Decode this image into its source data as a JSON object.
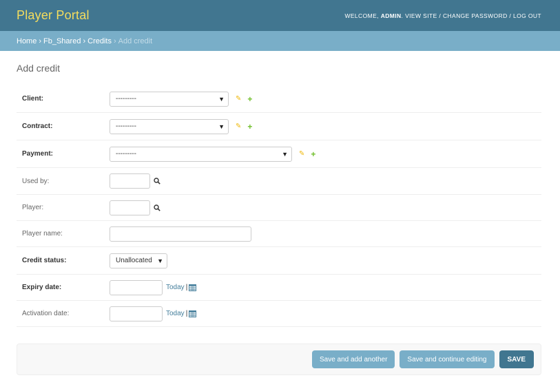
{
  "header": {
    "branding": "Player Portal",
    "welcome": "WELCOME,",
    "username": "ADMIN",
    "view_site": "VIEW SITE",
    "change_password": "CHANGE PASSWORD",
    "log_out": "LOG OUT",
    "separator": "/"
  },
  "breadcrumbs": {
    "home": "Home",
    "app": "Fb_Shared",
    "model": "Credits",
    "current": "Add credit",
    "separator": "›"
  },
  "page": {
    "title": "Add credit"
  },
  "form": {
    "client": {
      "label": "Client:",
      "value": "---------"
    },
    "contract": {
      "label": "Contract:",
      "value": "---------"
    },
    "payment": {
      "label": "Payment:",
      "value": "---------"
    },
    "used_by": {
      "label": "Used by:",
      "value": ""
    },
    "player": {
      "label": "Player:",
      "value": ""
    },
    "player_name": {
      "label": "Player name:",
      "value": ""
    },
    "credit_status": {
      "label": "Credit status:",
      "value": "Unallocated"
    },
    "expiry_date": {
      "label": "Expiry date:",
      "value": "",
      "today": "Today",
      "pipe": "|"
    },
    "activation_date": {
      "label": "Activation date:",
      "value": "",
      "today": "Today",
      "pipe": "|"
    }
  },
  "icons": {
    "dropdown_arrow": "▼",
    "edit": "✎",
    "add": "+"
  },
  "submit": {
    "save_add_another": "Save and add another",
    "save_continue": "Save and continue editing",
    "save": "SAVE"
  },
  "colors": {
    "header_bg": "#417690",
    "branding": "#f5dd5d",
    "breadcrumbs_bg": "#79aec8",
    "link": "#447e9b",
    "edit_icon": "#efb80b",
    "add_icon": "#70bf2b",
    "button_light": "#79aec8",
    "button_dark": "#417690"
  }
}
